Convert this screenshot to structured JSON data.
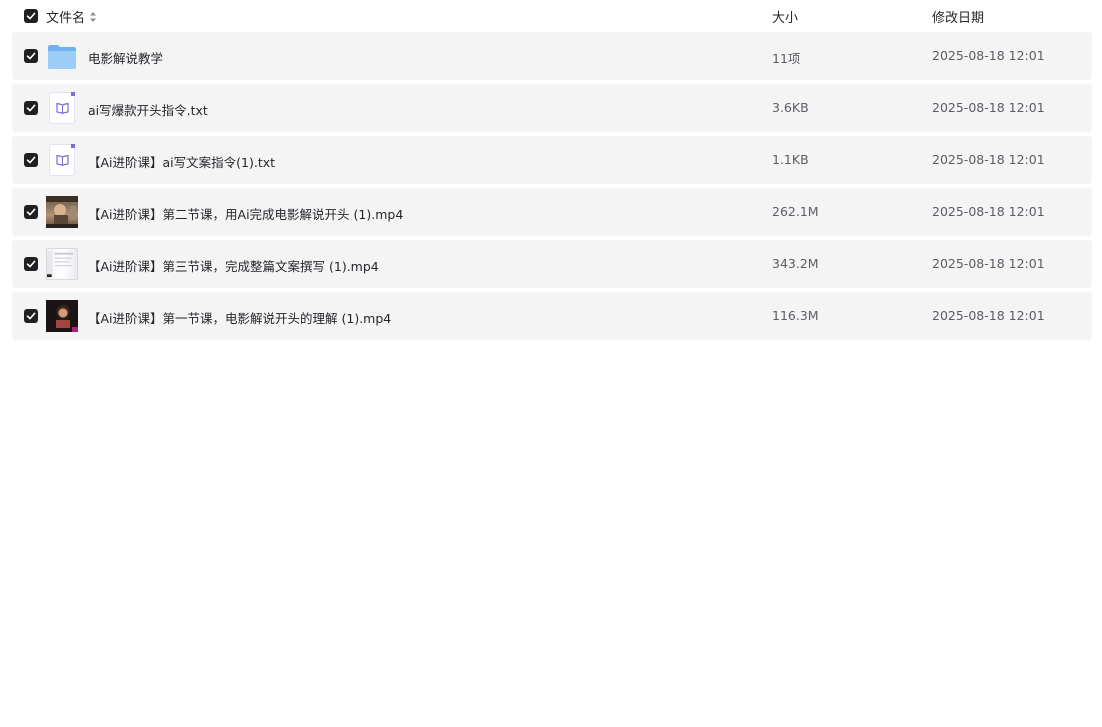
{
  "header": {
    "col_name": "文件名",
    "col_size": "大小",
    "col_date": "修改日期"
  },
  "colors": {
    "row_background": "#f4f4f5",
    "checkbox": "#1f2024",
    "doc_accent": "#7b6ad8",
    "folder": "#7cb8f0"
  },
  "files": [
    {
      "name": "电影解说教学",
      "size": "11项",
      "date": "2025-08-18 12:01",
      "icon": "folder-icon",
      "checked": true
    },
    {
      "name": "ai写爆款开头指令.txt",
      "size": "3.6KB",
      "date": "2025-08-18 12:01",
      "icon": "text-document-icon",
      "checked": true
    },
    {
      "name": "【Ai进阶课】ai写文案指令(1).txt",
      "size": "1.1KB",
      "date": "2025-08-18 12:01",
      "icon": "text-document-icon",
      "checked": true
    },
    {
      "name": "【Ai进阶课】第二节课，用Ai完成电影解说开头 (1).mp4",
      "size": "262.1M",
      "date": "2025-08-18 12:01",
      "icon": "video-thumbnail",
      "checked": true
    },
    {
      "name": "【Ai进阶课】第三节课，完成整篇文案撰写 (1).mp4",
      "size": "343.2M",
      "date": "2025-08-18 12:01",
      "icon": "video-thumbnail",
      "checked": true
    },
    {
      "name": "【Ai进阶课】第一节课，电影解说开头的理解 (1).mp4",
      "size": "116.3M",
      "date": "2025-08-18 12:01",
      "icon": "video-thumbnail",
      "checked": true
    }
  ]
}
